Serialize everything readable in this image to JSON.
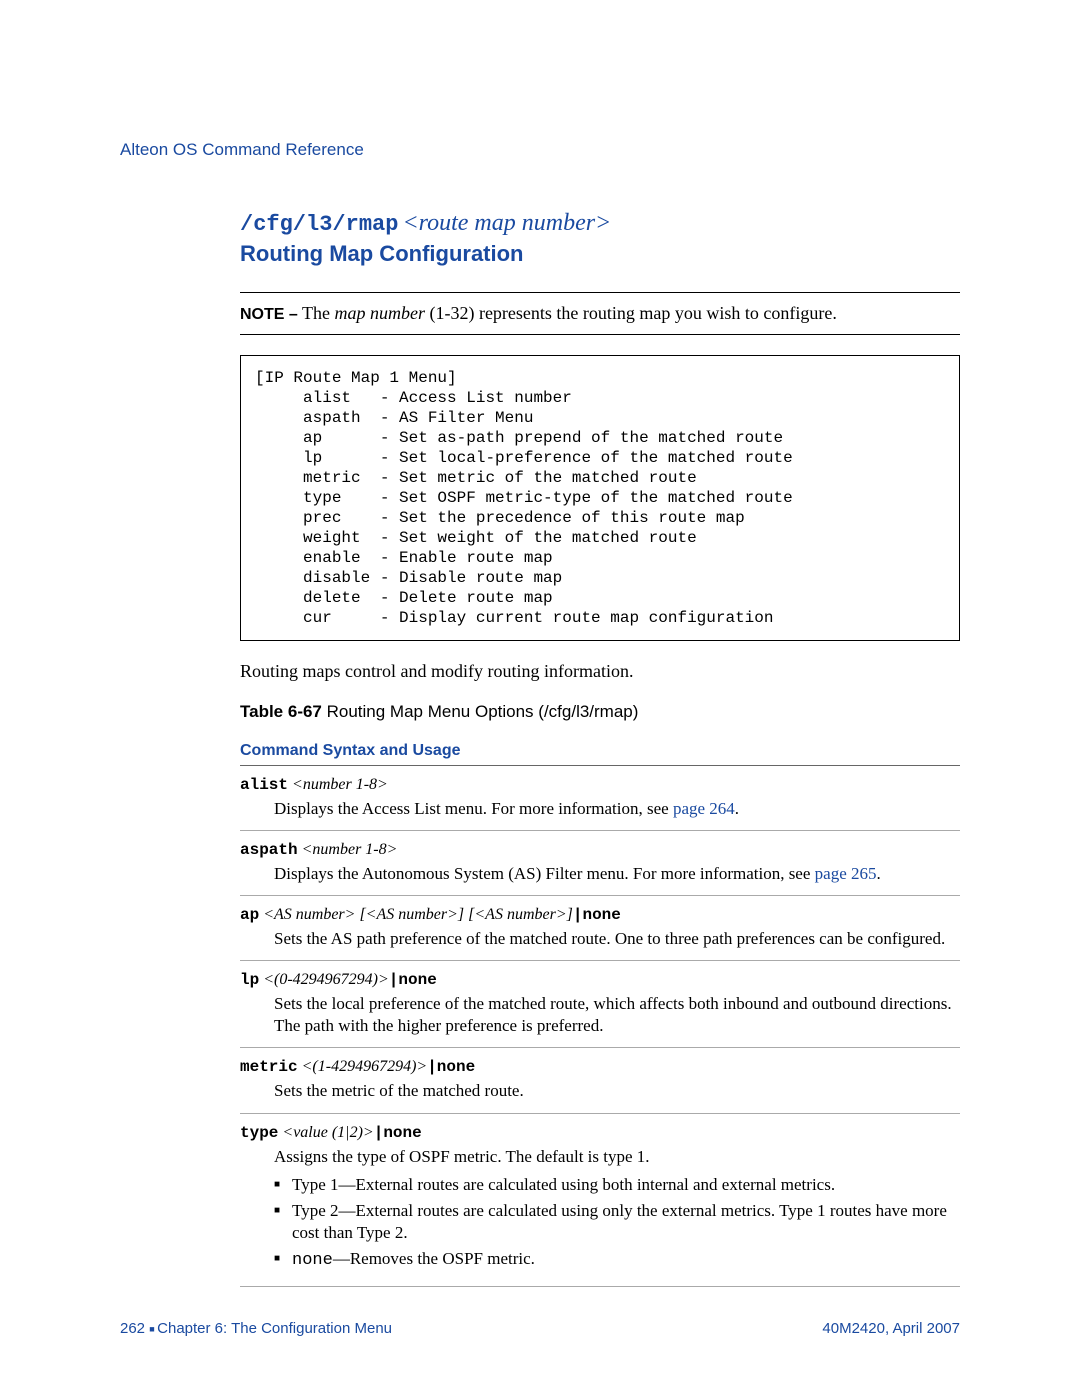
{
  "header": "Alteon OS Command Reference",
  "section": {
    "cmdpath": "/cfg/l3/rmap",
    "cmdparam": "<route map number>",
    "subtitle": "Routing Map Configuration"
  },
  "note": {
    "label": "NOTE –",
    "pre": " The ",
    "em": "map number",
    "post": " (1-32) represents the routing map you wish to configure."
  },
  "codebox": "[IP Route Map 1 Menu]\n     alist   - Access List number\n     aspath  - AS Filter Menu\n     ap      - Set as-path prepend of the matched route\n     lp      - Set local-preference of the matched route\n     metric  - Set metric of the matched route\n     type    - Set OSPF metric-type of the matched route\n     prec    - Set the precedence of this route map\n     weight  - Set weight of the matched route\n     enable  - Enable route map\n     disable - Disable route map\n     delete  - Delete route map\n     cur     - Display current route map configuration",
  "body1": "Routing maps control and modify routing information.",
  "table_caption_bold": "Table 6-67",
  "table_caption_rest": "  Routing Map Menu Options (/cfg/l3/rmap)",
  "syntax_header": "Command Syntax and Usage",
  "entries": {
    "alist": {
      "cmd": "alist",
      "arg": " <number 1-8>",
      "desc_pre": "Displays the Access List menu. For more information, see ",
      "link": "page 264",
      "desc_post": "."
    },
    "aspath": {
      "cmd": "aspath",
      "arg": " <number 1-8>",
      "desc_pre": "Displays the Autonomous System (AS) Filter menu. For more information, see ",
      "link": "page 265",
      "desc_post": "."
    },
    "ap": {
      "cmd": "ap",
      "arg": " <AS number> [<AS number>] [<AS number>]",
      "sep": "|",
      "none": "none",
      "desc": "Sets the AS path preference of the matched route. One to three path preferences can be configured."
    },
    "lp": {
      "cmd": "lp",
      "arg": " <(0-4294967294)>",
      "sep": "|",
      "none": "none",
      "desc": "Sets the local preference of the matched route, which affects both inbound and outbound directions. The path with the higher preference is preferred."
    },
    "metric": {
      "cmd": "metric",
      "arg": " <(1-4294967294)>",
      "sep": "|",
      "none": "none",
      "desc": "Sets the metric of the matched route."
    },
    "type": {
      "cmd": "type",
      "arg": " <value (1|2)>",
      "sep": "|",
      "none": "none",
      "desc": "Assigns the type of OSPF metric. The default is type 1.",
      "bullets": {
        "b1": "Type 1—External routes are calculated using both internal and external metrics.",
        "b2": "Type 2—External routes are calculated using only the external metrics. Type 1 routes have more cost than Type 2.",
        "b3_mono": "none",
        "b3_rest": "—Removes the OSPF metric."
      }
    }
  },
  "footer": {
    "page": "262",
    "chapter": "Chapter 6: The Configuration Menu",
    "doc": "40M2420, April 2007"
  }
}
